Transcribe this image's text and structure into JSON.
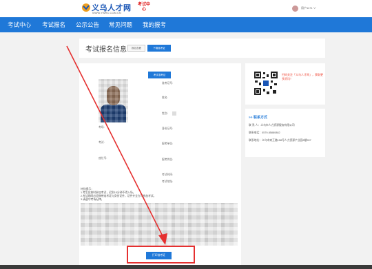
{
  "header": {
    "logo_text": "义乌人才网",
    "logo_url": "WWW.YWRC.COM.CN",
    "logo_badge": "考试中心",
    "user_name": "用户1171 ∨"
  },
  "nav": {
    "items": [
      "考试中心",
      "考试报名",
      "公示公告",
      "常见问题",
      "我的报考"
    ]
  },
  "title_card": {
    "title": "考试报名信息",
    "tab_inactive": "报名查看",
    "tab_active": "下载准考证"
  },
  "main": {
    "top_button": "考试准考证",
    "fields_right": [
      "准考证号:",
      "姓名:",
      "性别:",
      "身份证号:",
      "报考单位:",
      "报考岗位:",
      "考试时间:",
      "考试地址:"
    ],
    "fields_left": [
      "考场:",
      "考试:",
      "座位号:"
    ],
    "notes": [
      "特别提示：",
      "1.考生应按时参加考试，迟到15分钟不得入场。",
      "2.考试期间必须携带准考证与身份证件，证件齐全方可参加考试。",
      "3.请遵守考场纪律。"
    ],
    "print_button": "打印准考证"
  },
  "side": {
    "follow_text": "扫码关注「义乌人才网」，获取更多资讯！",
    "contact_title": "联系方式",
    "contact_person": "联 系 人：义乌市人力资源服务有限公司",
    "contact_phone": "联系电话：0579-85880882",
    "contact_address": "联系地址：义乌市宾王路158号人力资源产业园8楼907"
  },
  "colors": {
    "nav_blue": "#1f78d8",
    "highlight_red": "#e53030"
  }
}
